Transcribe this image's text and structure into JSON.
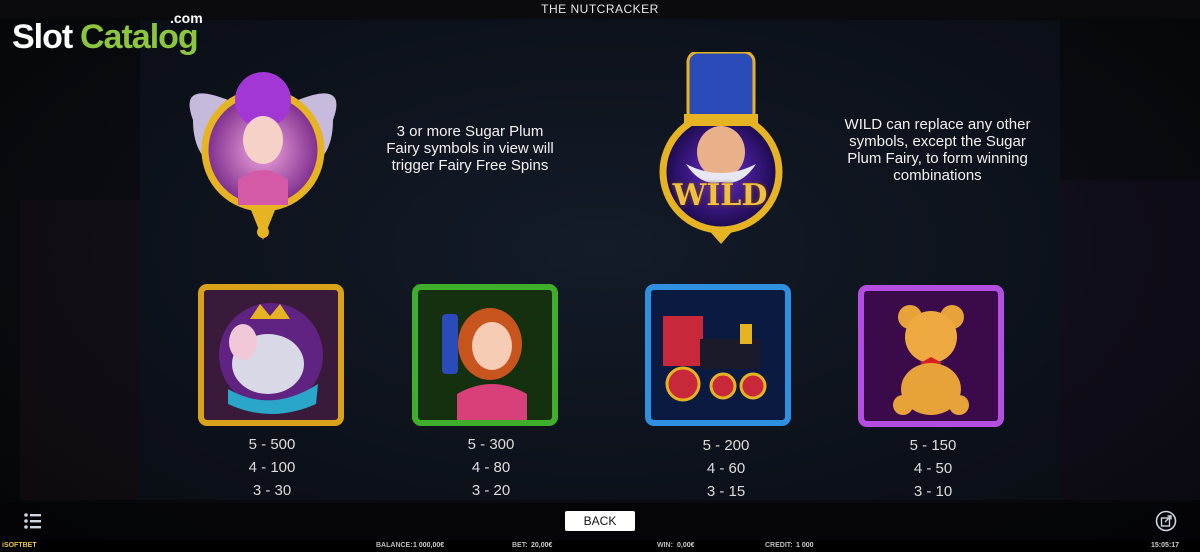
{
  "header": {
    "title": "THE NUTCRACKER"
  },
  "watermark": {
    "part1": "Slot",
    "part2": "Catalog",
    "part3": ".com"
  },
  "features": [
    {
      "symbol": "sugar-plum-fairy",
      "description": "3 or more Sugar Plum Fairy symbols in view will trigger Fairy Free Spins"
    },
    {
      "symbol": "wild-nutcracker",
      "wild_text": "WILD",
      "description": "WILD can replace any other symbols, except the Sugar Plum Fairy, to form winning combinations"
    }
  ],
  "paytable": [
    {
      "symbol": "mouse-king",
      "frame_color": "#d9a21b",
      "pays": [
        "5 - 500",
        "4 - 100",
        "3 - 30"
      ]
    },
    {
      "symbol": "clara",
      "frame_color": "#3fae2a",
      "pays": [
        "5 - 300",
        "4 - 80",
        "3 - 20"
      ]
    },
    {
      "symbol": "toy-train",
      "frame_color": "#2f8fe0",
      "pays": [
        "5 - 200",
        "4 - 60",
        "3 - 15"
      ]
    },
    {
      "symbol": "teddy-bear",
      "frame_color": "#b44ee0",
      "pays": [
        "5 - 150",
        "4 - 50",
        "3 - 10"
      ]
    }
  ],
  "controls": {
    "back_label": "BACK",
    "menu_icon": "list-icon",
    "share_icon": "external-link-icon"
  },
  "status_bar": {
    "brand": "iSOFTBET",
    "balance_label": "BALANCE:",
    "balance_value": "1 000,00€",
    "bet_label": "BET:",
    "bet_value": "20,00€",
    "win_label": "WIN:",
    "win_value": "0,00€",
    "credit_label": "CREDIT:",
    "credit_value": "1 000",
    "time": "15:05:17"
  }
}
